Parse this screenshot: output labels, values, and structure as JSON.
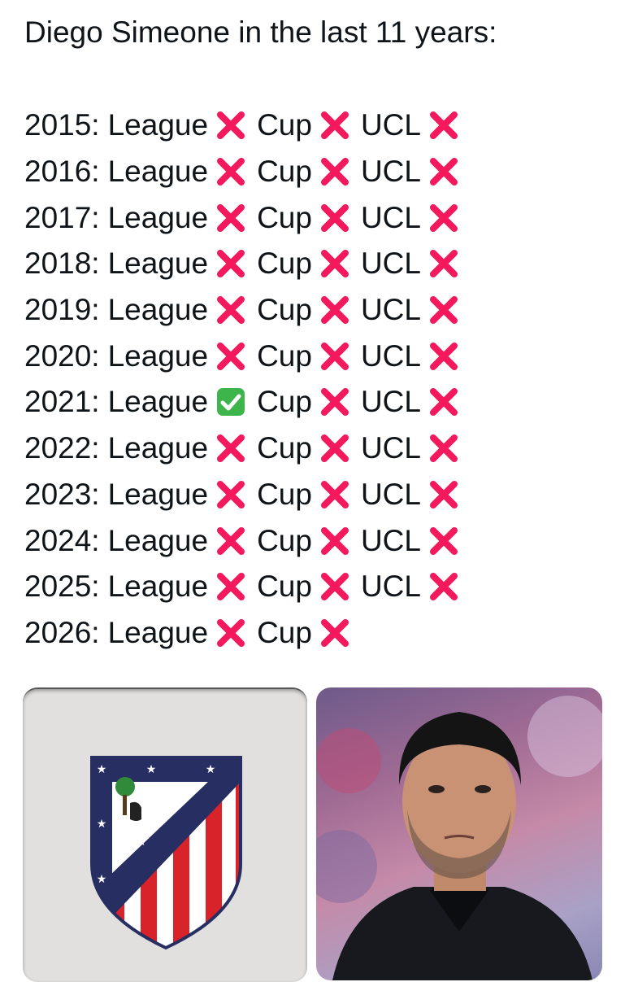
{
  "post": {
    "title": "Diego Simeone in the last 11 years:",
    "rows": [
      {
        "year": "2015:",
        "league_label": "League",
        "league": "x",
        "cup_label": "Cup",
        "cup": "x",
        "ucl_label": "UCL",
        "ucl": "x"
      },
      {
        "year": "2016:",
        "league_label": "League",
        "league": "x",
        "cup_label": "Cup",
        "cup": "x",
        "ucl_label": "UCL",
        "ucl": "x"
      },
      {
        "year": "2017:",
        "league_label": "League",
        "league": "x",
        "cup_label": "Cup",
        "cup": "x",
        "ucl_label": "UCL",
        "ucl": "x"
      },
      {
        "year": "2018:",
        "league_label": "League",
        "league": "x",
        "cup_label": "Cup",
        "cup": "x",
        "ucl_label": "UCL",
        "ucl": "x"
      },
      {
        "year": "2019:",
        "league_label": "League",
        "league": "x",
        "cup_label": "Cup",
        "cup": "x",
        "ucl_label": "UCL",
        "ucl": "x"
      },
      {
        "year": "2020:",
        "league_label": "League",
        "league": "x",
        "cup_label": "Cup",
        "cup": "x",
        "ucl_label": "UCL",
        "ucl": "x"
      },
      {
        "year": "2021:",
        "league_label": "League",
        "league": "check",
        "cup_label": "Cup",
        "cup": "x",
        "ucl_label": "UCL",
        "ucl": "x"
      },
      {
        "year": "2022:",
        "league_label": "League",
        "league": "x",
        "cup_label": "Cup",
        "cup": "x",
        "ucl_label": "UCL",
        "ucl": "x"
      },
      {
        "year": "2023:",
        "league_label": "League",
        "league": "x",
        "cup_label": "Cup",
        "cup": "x",
        "ucl_label": "UCL",
        "ucl": "x"
      },
      {
        "year": "2024:",
        "league_label": "League",
        "league": "x",
        "cup_label": "Cup",
        "cup": "x",
        "ucl_label": "UCL",
        "ucl": "x"
      },
      {
        "year": "2025:",
        "league_label": "League",
        "league": "x",
        "cup_label": "Cup",
        "cup": "x",
        "ucl_label": "UCL",
        "ucl": "x"
      },
      {
        "year": "2026:",
        "league_label": "League",
        "league": "x",
        "cup_label": "Cup",
        "cup": "x"
      }
    ]
  },
  "icons": {
    "x": "cross-mark-icon",
    "check": "check-mark-button-icon"
  },
  "colors": {
    "cross": "#f4185c",
    "check_bg": "#3db54a",
    "crest_red": "#d8232a",
    "crest_blue": "#272e61"
  }
}
